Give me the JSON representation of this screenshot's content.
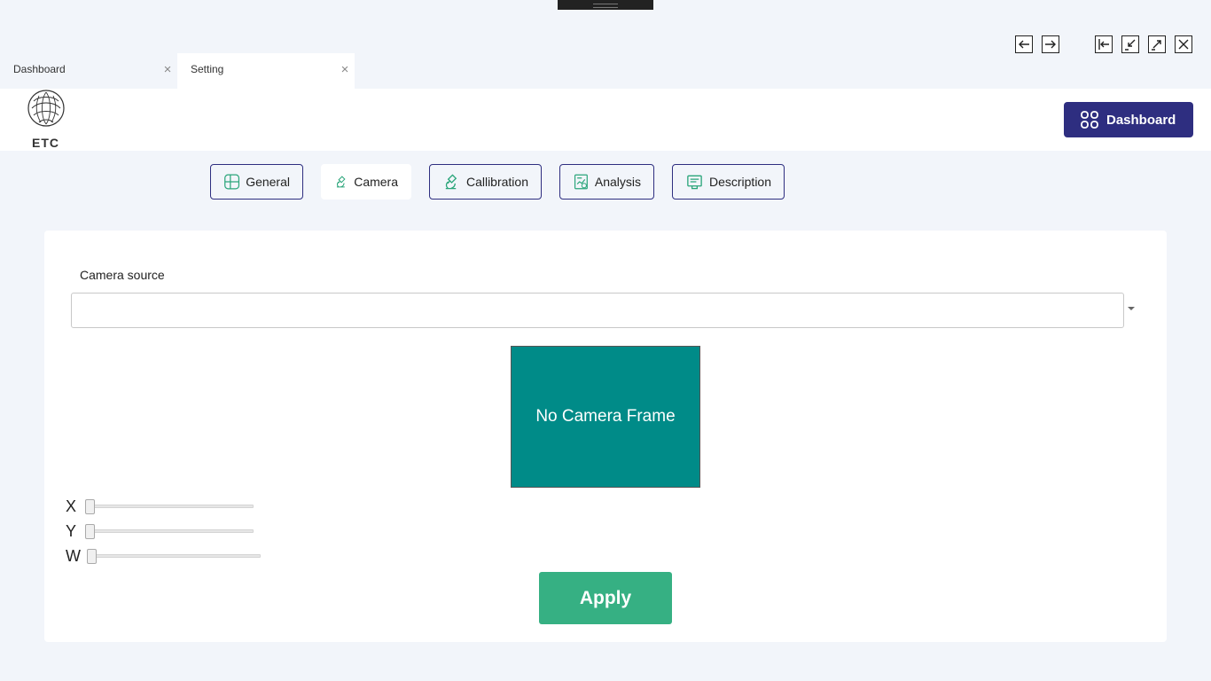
{
  "tabs": [
    {
      "label": "Dashboard",
      "active": false
    },
    {
      "label": "Setting",
      "active": true
    }
  ],
  "window_controls": [
    "back-icon",
    "forward-icon",
    "exit-icon",
    "minimize-icon",
    "maximize-icon",
    "close-icon"
  ],
  "header": {
    "logo_text": "ETC",
    "dashboard_button": "Dashboard"
  },
  "settings_tabs": [
    {
      "label": "General",
      "icon": "grid-icon",
      "active": false
    },
    {
      "label": "Camera",
      "icon": "microscope-icon",
      "active": true
    },
    {
      "label": "Callibration",
      "icon": "microscope-icon",
      "active": false
    },
    {
      "label": "Analysis",
      "icon": "analysis-icon",
      "active": false
    },
    {
      "label": "Description",
      "icon": "description-icon",
      "active": false
    }
  ],
  "camera": {
    "source_label": "Camera source",
    "source_value": "",
    "frame_text": "No Camera Frame",
    "sliders": [
      {
        "label": "X",
        "value": 0
      },
      {
        "label": "Y",
        "value": 0
      },
      {
        "label": "W",
        "value": 0
      }
    ],
    "apply_label": "Apply"
  },
  "colors": {
    "accent": "#2e2e80",
    "frame": "#008b88",
    "apply": "#36b083",
    "icon_green": "#2aa57a"
  }
}
